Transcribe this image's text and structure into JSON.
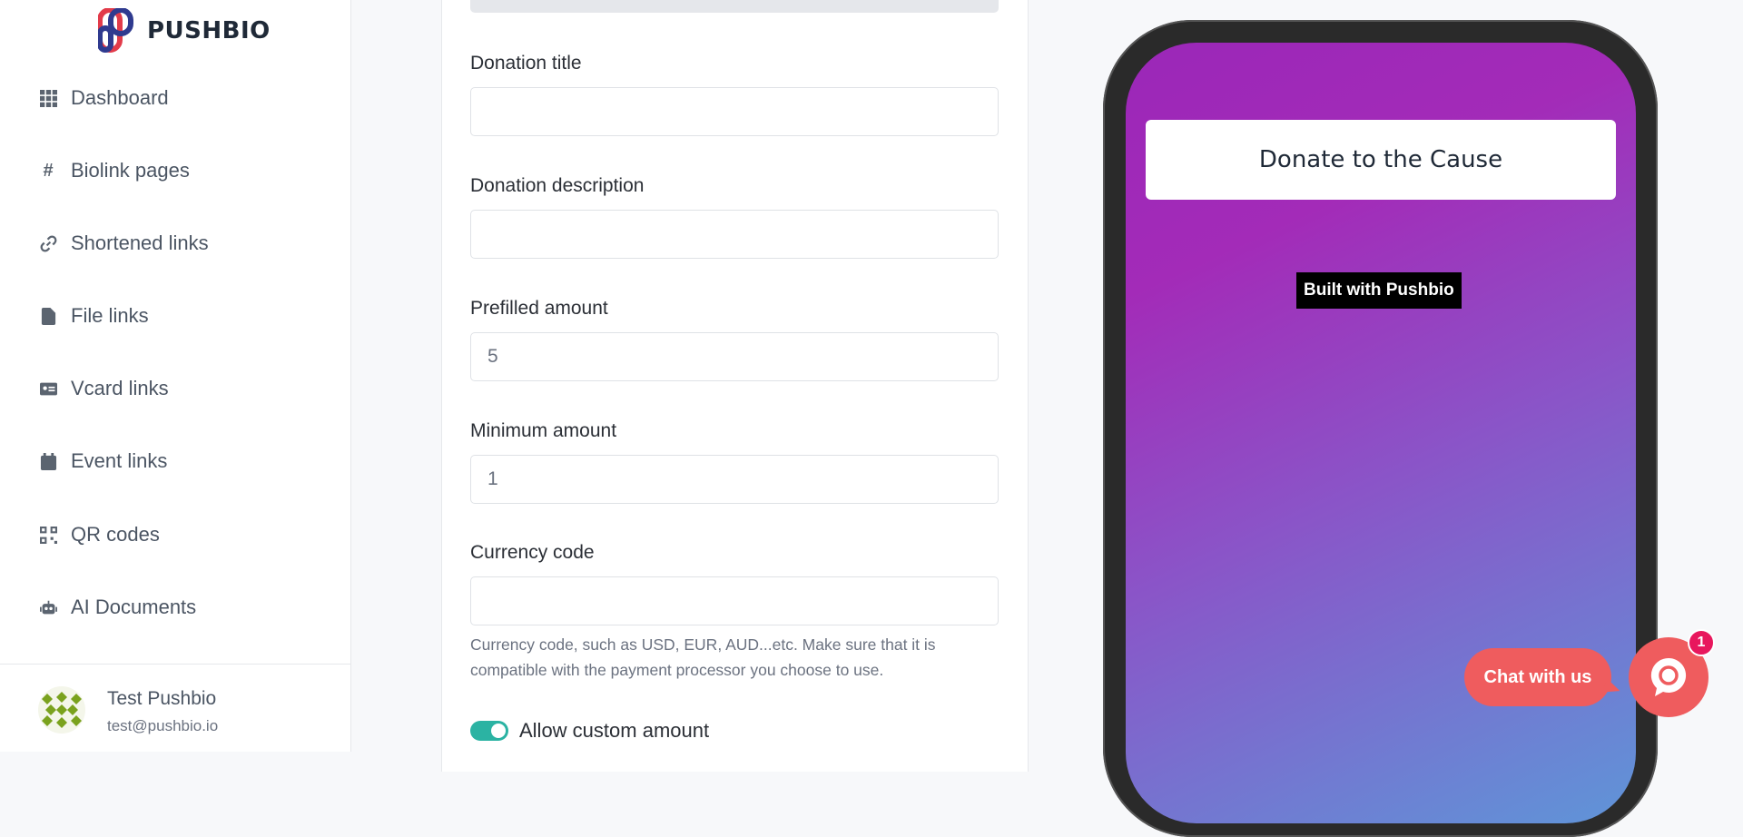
{
  "brand": {
    "name": "PUSHBIO",
    "accent": "#2bb3a3",
    "chat_color": "#ef5c5e"
  },
  "sidebar": {
    "items": [
      {
        "label": "Dashboard",
        "icon": "grid-icon"
      },
      {
        "label": "Biolink pages",
        "icon": "hash-icon"
      },
      {
        "label": "Shortened links",
        "icon": "link-icon"
      },
      {
        "label": "File links",
        "icon": "file-icon"
      },
      {
        "label": "Vcard links",
        "icon": "id-card-icon"
      },
      {
        "label": "Event links",
        "icon": "calendar-icon"
      },
      {
        "label": "QR codes",
        "icon": "qrcode-icon"
      },
      {
        "label": "AI Documents",
        "icon": "robot-icon"
      }
    ],
    "user": {
      "name": "Test Pushbio",
      "email": "test@pushbio.io"
    }
  },
  "form": {
    "donation_title": {
      "label": "Donation title",
      "value": "",
      "placeholder": ""
    },
    "donation_description": {
      "label": "Donation description",
      "value": "",
      "placeholder": ""
    },
    "prefilled_amount": {
      "label": "Prefilled amount",
      "value": "5"
    },
    "minimum_amount": {
      "label": "Minimum amount",
      "value": "1"
    },
    "currency_code": {
      "label": "Currency code",
      "value": "",
      "help": "Currency code, such as USD, EUR, AUD...etc. Make sure that it is compatible with the payment processor you choose to use."
    },
    "allow_custom_amount": {
      "label": "Allow custom amount",
      "enabled": true
    }
  },
  "preview": {
    "button_text": "Donate to the Cause",
    "badge_text": "Built with Pushbio"
  },
  "chat": {
    "label": "Chat with us",
    "count": "1"
  }
}
